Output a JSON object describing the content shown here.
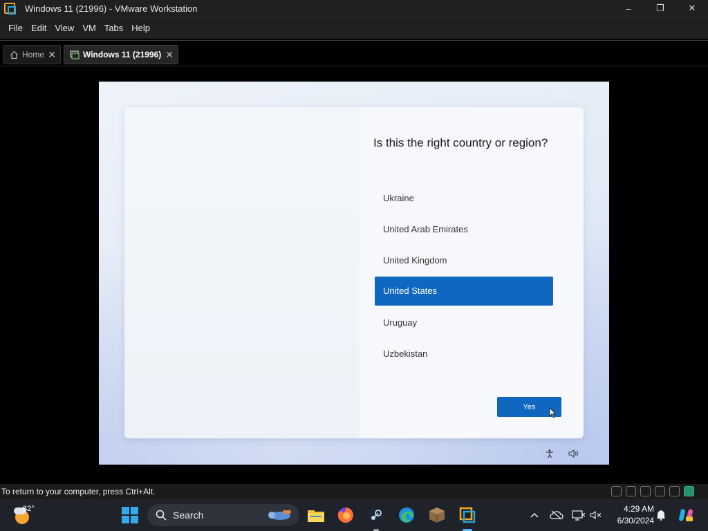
{
  "window": {
    "title": "Windows 11 (21996) - VMware Workstation",
    "controls": {
      "minimize": "–",
      "restore": "❐",
      "close": "✕"
    }
  },
  "menu": [
    "File",
    "Edit",
    "View",
    "VM",
    "Tabs",
    "Help"
  ],
  "tabs": [
    {
      "label": "Home",
      "icon": "home-icon",
      "active": false
    },
    {
      "label": "Windows 11 (21996)",
      "icon": "vm-icon",
      "active": true
    }
  ],
  "oobe": {
    "question": "Is this the right country or region?",
    "countries": [
      "Ukraine",
      "United Arab Emirates",
      "United Kingdom",
      "United States",
      "Uruguay",
      "Uzbekistan"
    ],
    "selected": "United States",
    "yes_label": "Yes"
  },
  "statusbar": {
    "text": "To return to your computer, press Ctrl+Alt."
  },
  "taskbar": {
    "weather_temp": "82°",
    "search_label": "Search",
    "time": "4:29 AM",
    "date": "6/30/2024"
  },
  "colors": {
    "accent": "#0f67c0",
    "titlebar": "#202020",
    "taskbar": "#1f2229"
  }
}
